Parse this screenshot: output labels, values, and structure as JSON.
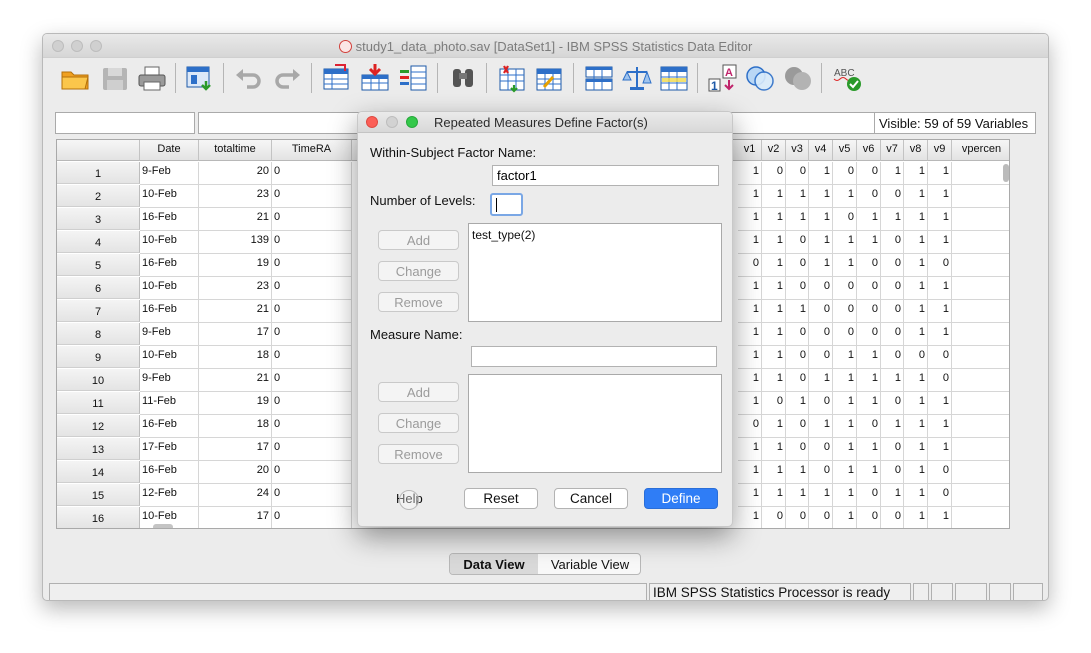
{
  "window": {
    "title": "study1_data_photo.sav [DataSet1] - IBM SPSS Statistics Data Editor"
  },
  "toolbar": {
    "icons": [
      "open-folder-icon",
      "save-icon",
      "print-icon",
      "recall-dialog-icon",
      "undo-icon",
      "redo-icon",
      "go-to-case-icon",
      "go-to-variable-icon",
      "variables-icon",
      "find-icon",
      "insert-cases-icon",
      "insert-variable-icon",
      "split-file-icon",
      "weight-cases-icon",
      "select-cases-icon",
      "value-labels-icon",
      "use-sets-icon",
      "show-all-variables-icon",
      "spell-check-icon"
    ]
  },
  "varbar": {
    "visible_text": "Visible: 59 of 59 Variables"
  },
  "grid": {
    "left_headers": [
      "Date",
      "totaltime",
      "TimeRA"
    ],
    "right_headers": [
      "v1",
      "v2",
      "v3",
      "v4",
      "v5",
      "v6",
      "v7",
      "v8",
      "v9",
      "vpercen"
    ],
    "rows": [
      {
        "n": "1",
        "date": "9-Feb",
        "total": "20",
        "ra": "0",
        "v": [
          "1",
          "0",
          "0",
          "1",
          "0",
          "0",
          "1",
          "1",
          "1"
        ]
      },
      {
        "n": "2",
        "date": "10-Feb",
        "total": "23",
        "ra": "0",
        "v": [
          "1",
          "1",
          "1",
          "1",
          "1",
          "0",
          "0",
          "1",
          "1"
        ]
      },
      {
        "n": "3",
        "date": "16-Feb",
        "total": "21",
        "ra": "0",
        "v": [
          "1",
          "1",
          "1",
          "1",
          "0",
          "1",
          "1",
          "1",
          "1"
        ]
      },
      {
        "n": "4",
        "date": "10-Feb",
        "total": "139",
        "ra": "0",
        "v": [
          "1",
          "1",
          "0",
          "1",
          "1",
          "1",
          "0",
          "1",
          "1"
        ]
      },
      {
        "n": "5",
        "date": "16-Feb",
        "total": "19",
        "ra": "0",
        "v": [
          "0",
          "1",
          "0",
          "1",
          "1",
          "0",
          "0",
          "1",
          "0"
        ]
      },
      {
        "n": "6",
        "date": "10-Feb",
        "total": "23",
        "ra": "0",
        "v": [
          "1",
          "1",
          "0",
          "0",
          "0",
          "0",
          "0",
          "1",
          "1"
        ]
      },
      {
        "n": "7",
        "date": "16-Feb",
        "total": "21",
        "ra": "0",
        "v": [
          "1",
          "1",
          "1",
          "0",
          "0",
          "0",
          "0",
          "1",
          "1"
        ]
      },
      {
        "n": "8",
        "date": "9-Feb",
        "total": "17",
        "ra": "0",
        "v": [
          "1",
          "1",
          "0",
          "0",
          "0",
          "0",
          "0",
          "1",
          "1"
        ]
      },
      {
        "n": "9",
        "date": "10-Feb",
        "total": "18",
        "ra": "0",
        "v": [
          "1",
          "1",
          "0",
          "0",
          "1",
          "1",
          "0",
          "0",
          "0"
        ]
      },
      {
        "n": "10",
        "date": "9-Feb",
        "total": "21",
        "ra": "0",
        "v": [
          "1",
          "1",
          "0",
          "1",
          "1",
          "1",
          "1",
          "1",
          "0"
        ]
      },
      {
        "n": "11",
        "date": "11-Feb",
        "total": "19",
        "ra": "0",
        "v": [
          "1",
          "0",
          "1",
          "0",
          "1",
          "1",
          "0",
          "1",
          "1"
        ]
      },
      {
        "n": "12",
        "date": "16-Feb",
        "total": "18",
        "ra": "0",
        "v": [
          "0",
          "1",
          "0",
          "1",
          "1",
          "0",
          "1",
          "1",
          "1"
        ]
      },
      {
        "n": "13",
        "date": "17-Feb",
        "total": "17",
        "ra": "0",
        "v": [
          "1",
          "1",
          "0",
          "0",
          "1",
          "1",
          "0",
          "1",
          "1"
        ]
      },
      {
        "n": "14",
        "date": "16-Feb",
        "total": "20",
        "ra": "0",
        "v": [
          "1",
          "1",
          "1",
          "0",
          "1",
          "1",
          "0",
          "1",
          "0"
        ]
      },
      {
        "n": "15",
        "date": "12-Feb",
        "total": "24",
        "ra": "0",
        "v": [
          "1",
          "1",
          "1",
          "1",
          "1",
          "0",
          "1",
          "1",
          "0"
        ]
      },
      {
        "n": "16",
        "date": "10-Feb",
        "total": "17",
        "ra": "0",
        "v": [
          "1",
          "0",
          "0",
          "0",
          "1",
          "0",
          "0",
          "1",
          "1"
        ]
      }
    ]
  },
  "tabs": {
    "data_view": "Data View",
    "variable_view": "Variable View"
  },
  "status": {
    "text": "IBM SPSS Statistics Processor is ready"
  },
  "dialog": {
    "title": "Repeated Measures Define Factor(s)",
    "factor_name_label": "Within-Subject Factor Name:",
    "factor_name_value": "factor1",
    "levels_label": "Number of Levels:",
    "levels_value": "",
    "factor_buttons": [
      "Add",
      "Change",
      "Remove"
    ],
    "factor_list": [
      "test_type(2)"
    ],
    "measure_name_label": "Measure Name:",
    "measure_name_value": "",
    "measure_buttons": [
      "Add",
      "Change",
      "Remove"
    ],
    "help_label": "Help",
    "reset_label": "Reset",
    "cancel_label": "Cancel",
    "define_label": "Define"
  },
  "colors": {
    "define_button": "#2f7df6",
    "close_light": "#fc5f57",
    "zoom_light": "#34c84a"
  }
}
